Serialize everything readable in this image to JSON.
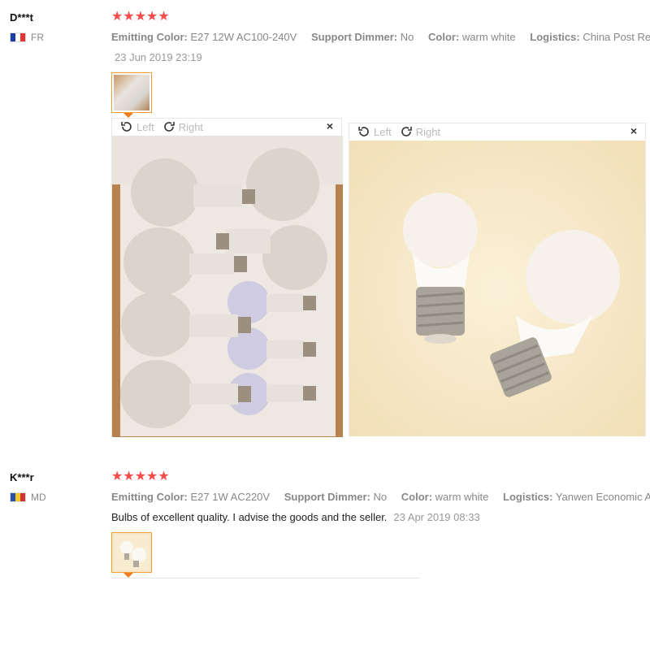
{
  "reviews": [
    {
      "user": "D***t",
      "country": "FR",
      "flag_colors": [
        "#1b3da8",
        "#ffffff",
        "#e33333"
      ],
      "stars": "★★★★★",
      "attrs": [
        {
          "key": "Emitting Color:",
          "value": "E27 12W AC100-240V"
        },
        {
          "key": "Support Dimmer:",
          "value": "No"
        },
        {
          "key": "Color:",
          "value": "warm white"
        },
        {
          "key": "Logistics:",
          "value": "China Post Regis"
        }
      ],
      "date": "23 Jun 2019 23:19",
      "viewers": [
        {
          "left": "Left",
          "right": "Right",
          "close": "×"
        },
        {
          "left": "Left",
          "right": "Right",
          "close": "×"
        }
      ]
    },
    {
      "user": "K***r",
      "country": "MD",
      "flag_colors": [
        "#2b4ea8",
        "#f2cc2a",
        "#d33333"
      ],
      "stars": "★★★★★",
      "attrs": [
        {
          "key": "Emitting Color:",
          "value": "E27 1W AC220V"
        },
        {
          "key": "Support Dimmer:",
          "value": "No"
        },
        {
          "key": "Color:",
          "value": "warm white"
        },
        {
          "key": "Logistics:",
          "value": "Yanwen Economic Air"
        }
      ],
      "text": "Bulbs of excellent quality. I advise the goods and the seller.",
      "date": "23 Apr 2019 08:33"
    }
  ],
  "colors": {
    "star": "#f44b4b",
    "accent": "#f27a18"
  },
  "icons": {
    "rotate_left": "rotate-left-icon",
    "rotate_right": "rotate-right-icon",
    "close": "close-icon"
  }
}
